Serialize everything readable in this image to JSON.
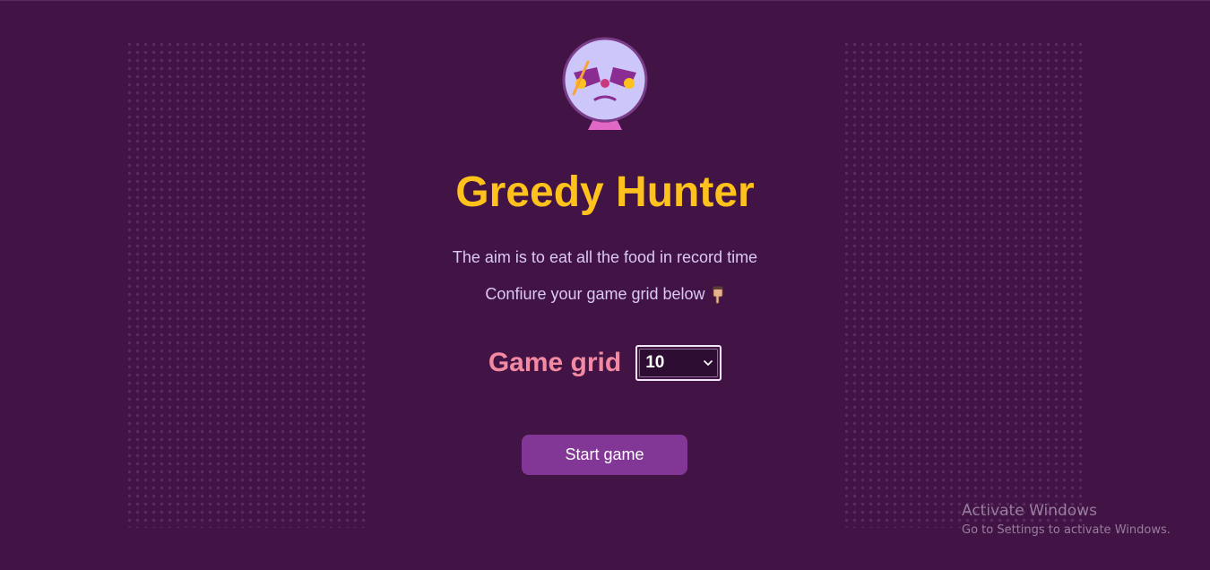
{
  "game": {
    "title": "Greedy Hunter",
    "subtitle_aim": "The aim is to eat all the food in record time",
    "subtitle_configure": "Confiure your game grid below",
    "grid_label": "Game grid",
    "grid_value": "10",
    "start_label": "Start game"
  },
  "icons": {
    "avatar": "hunter-face-icon",
    "pointer": "hand-pointing-down-icon",
    "dropdown": "chevron-down-icon"
  },
  "watermark": {
    "line1": "Activate Windows",
    "line2": "Go to Settings to activate Windows."
  },
  "colors": {
    "background": "#411445",
    "title": "#ffc21c",
    "subtitle": "#dcc9f2",
    "grid_label": "#f48aa2",
    "button": "#823695",
    "avatar_face": "#cdc6fb"
  }
}
